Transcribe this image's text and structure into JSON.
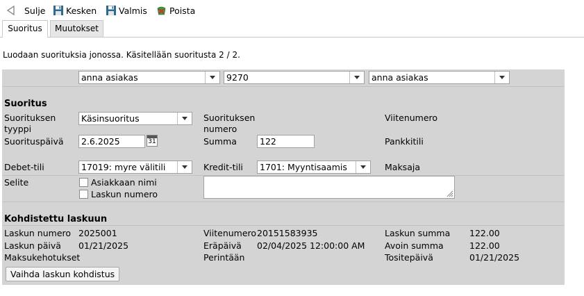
{
  "toolbar": {
    "close_label": "Sulje",
    "interrupt_label": "Kesken",
    "done_label": "Valmis",
    "delete_label": "Poista"
  },
  "tabs": [
    {
      "label": "Suoritus",
      "active": true
    },
    {
      "label": "Muutokset",
      "active": false
    }
  ],
  "info_text": "Luodaan suorituksia jonossa. Käsitellään suoritusta 2 / 2.",
  "top_selects": {
    "customer": "anna asiakas",
    "number": "9270",
    "customer2": "anna asiakas"
  },
  "suoritus": {
    "heading": "Suoritus",
    "type_label": "Suorituksen tyyppi",
    "type_label_l1": "Suorituksen",
    "type_label_l2": "tyyppi",
    "type_value": "Käsinsuoritus",
    "number_label_l1": "Suorituksen",
    "number_label_l2": "numero",
    "reference_label": "Viitenumero",
    "date_label": "Suorituspäivä",
    "date_value": "2.6.2025",
    "calendar_day": "31",
    "amount_label": "Summa",
    "amount_value": "122",
    "bank_label": "Pankkitili",
    "debit_label": "Debet-tili",
    "debit_value": "17019: myre välitili",
    "credit_label": "Kredit-tili",
    "credit_value": "1701: Myyntisaamis",
    "payer_label": "Maksaja",
    "note_label": "Selite",
    "chk_customer_name": "Asiakkaan nimi",
    "chk_invoice_number": "Laskun numero"
  },
  "kohdistettu": {
    "heading": "Kohdistettu laskuun",
    "invoice_number_label": "Laskun numero",
    "invoice_number_value": "2025001",
    "reference_label": "Viitenumero",
    "reference_value": "20151583935",
    "invoice_sum_label": "Laskun summa",
    "invoice_sum_value": "122.00",
    "invoice_date_label": "Laskun päivä",
    "invoice_date_value": "01/21/2025",
    "due_label": "Eräpäivä",
    "due_value": "02/04/2025 12:00:00 AM",
    "open_sum_label": "Avoin summa",
    "open_sum_value": "122.00",
    "payment_requests_label": "Maksukehotukset",
    "collection_label": "Perintään",
    "voucher_date_label": "Tositepäivä",
    "voucher_date_value": "01/21/2025",
    "change_button": "Vaihda laskun kohdistus"
  },
  "colors": {
    "panel": "#d4d4d4",
    "save_icon": "#2f6a8c",
    "delete_icon": "#c8302a"
  }
}
